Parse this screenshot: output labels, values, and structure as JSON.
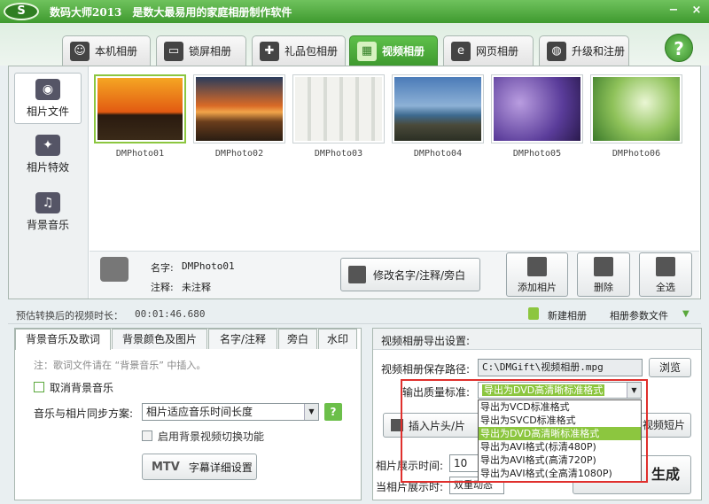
{
  "app": {
    "logo": "S",
    "title": "数码大师2013　是数大最易用的家庭相册制作软件",
    "min": "−",
    "close": "×"
  },
  "tabs": [
    {
      "label": "本机相册",
      "icon": "person-icon"
    },
    {
      "label": "锁屏相册",
      "icon": "monitor-icon"
    },
    {
      "label": "礼品包相册",
      "icon": "gift-icon"
    },
    {
      "label": "视频相册",
      "icon": "film-icon"
    },
    {
      "label": "网页相册",
      "icon": "ie-icon"
    },
    {
      "label": "升级和注册",
      "icon": "globe-icon"
    }
  ],
  "help": "?",
  "sidebar": [
    {
      "label": "相片文件",
      "icon": "camera-icon"
    },
    {
      "label": "相片特效",
      "icon": "effects-icon"
    },
    {
      "label": "背景音乐",
      "icon": "music-icon"
    }
  ],
  "photos": [
    "DMPhoto01",
    "DMPhoto02",
    "DMPhoto03",
    "DMPhoto04",
    "DMPhoto05",
    "DMPhoto06"
  ],
  "info": {
    "name_label": "名字:",
    "name_value": "DMPhoto01",
    "note_label": "注释:",
    "note_value": "未注释",
    "edit_btn": "修改名字/注释/旁白"
  },
  "actions": {
    "add": "添加相片",
    "delete": "删除",
    "select_all": "全选"
  },
  "estimate": {
    "label": "预估转换后的视频时长：",
    "value": "00:01:46.680",
    "new_album": "新建相册",
    "album_params": "相册参数文件"
  },
  "subtabs": [
    "背景音乐及歌词",
    "背景颜色及图片",
    "名字/注释",
    "旁白",
    "水印"
  ],
  "left": {
    "note": "注：歌词文件请在 “背景音乐” 中插入。",
    "cancel_bg": "取消背景音乐",
    "sync_label": "音乐与相片同步方案:",
    "sync_value": "相片适应音乐时间长度",
    "sync_help": "?",
    "bg_video": "启用背景视频切换功能",
    "mtv_btn": "字幕详细设置",
    "mtv_logo": "MTV"
  },
  "right": {
    "header": "视频相册导出设置:",
    "path_label": "视频相册保存路径:",
    "path_value": "C:\\DMGift\\视频相册.mpg",
    "browse": "浏览",
    "quality_label": "输出质量标准:",
    "quality_value": "导出为DVD高清晰标准格式",
    "options": [
      "导出为VCD标准格式",
      "导出为SVCD标准格式",
      "导出为DVD高清晰标准格式",
      "导出为AVI格式(标清480P)",
      "导出为AVI格式(高清720P)",
      "导出为AVI格式(全高清1080P)"
    ],
    "insert_btn": "插入片头/片",
    "short_btn": "视频短片",
    "show_time_label": "相片展示时间:",
    "show_time_value": "10",
    "show_label": "当相片展示时:",
    "show_value": "双重动态",
    "generate": "生成"
  }
}
